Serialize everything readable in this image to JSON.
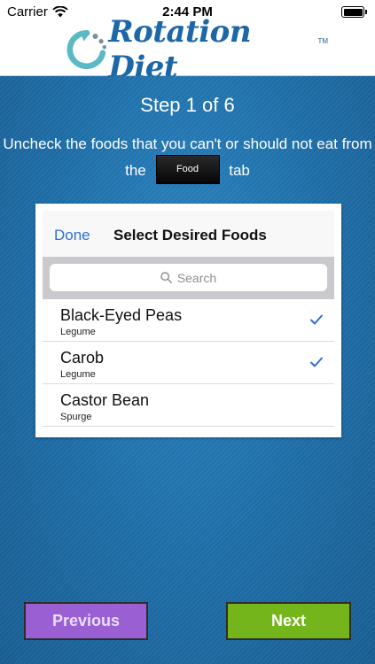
{
  "status_bar": {
    "carrier": "Carrier",
    "time": "2:44 PM"
  },
  "header": {
    "logo_text": "Rotation Diet",
    "logo_tm": "TM"
  },
  "tutorial": {
    "step": "Step 1 of 6",
    "instruction_before": "Uncheck the foods that you can't or should not eat from the",
    "tab_label": "Food",
    "instruction_after": "tab"
  },
  "preview": {
    "done_label": "Done",
    "title": "Select Desired Foods",
    "search_placeholder": "Search",
    "items": [
      {
        "name": "Black-Eyed Peas",
        "category": "Legume",
        "checked": true
      },
      {
        "name": "Carob",
        "category": "Legume",
        "checked": true
      },
      {
        "name": "Castor Bean",
        "category": "Spurge",
        "checked": false
      }
    ]
  },
  "buttons": {
    "previous": "Previous",
    "next": "Next"
  },
  "colors": {
    "background_blue": "#1f6fa8",
    "logo_blue": "#1c67a8",
    "previous_purple": "#9a5fd3",
    "next_green": "#74b51c",
    "check_blue": "#2f6fd6"
  }
}
